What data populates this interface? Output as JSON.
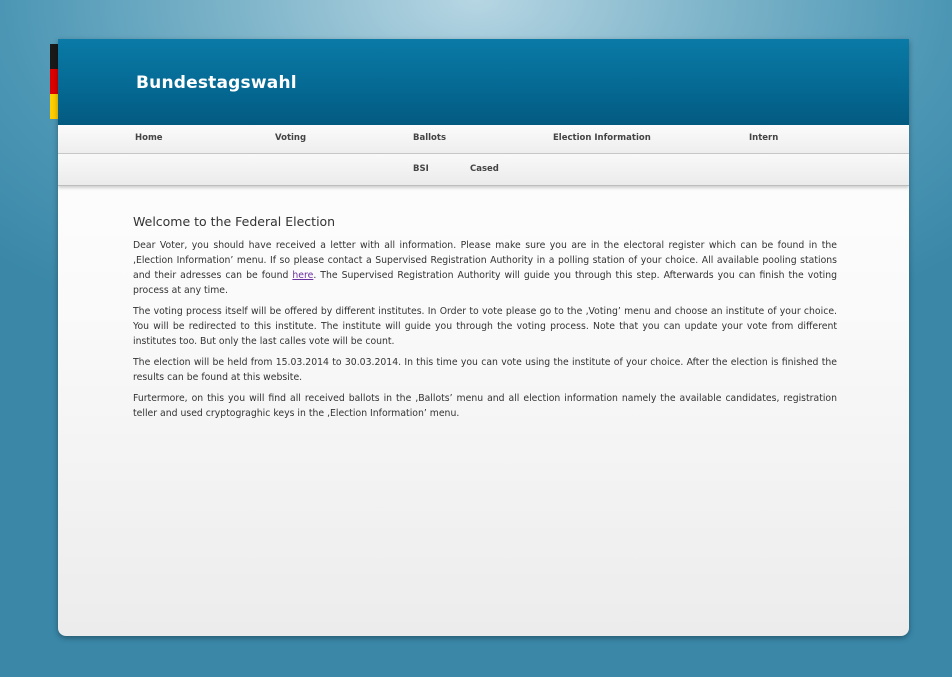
{
  "header": {
    "title": "Bundestagswahl"
  },
  "nav": {
    "main": [
      "Home",
      "Voting",
      "Ballots",
      "Election Information",
      "Intern"
    ],
    "sub": [
      "BSI",
      "Cased"
    ]
  },
  "content": {
    "heading": "Welcome to the Federal Election",
    "p1_before": "Dear Voter, you should have received a letter with all information. Please make sure you are in the electoral register which can be found in the ‚Election Information’ menu. If so please contact a Supervised Registration Authority in a polling station of your choice. All available pooling stations and their adresses can be found ",
    "p1_link": "here",
    "p1_after": ". The Supervised Registration Authority will guide you through this step. Afterwards you can finish the voting process at any time.",
    "p2": "The voting process itself will be offered by different institutes. In Order to vote please go to the ‚Voting’ menu and choose an institute of your choice. You will be redirected to this institute. The institute will guide you through the voting process. Note that you can update your vote from different institutes too. But only the last calles vote will be count.",
    "p3": "The election will be held from 15.03.2014 to 30.03.2014. In this time you can vote using the institute of your choice. After the election is finished the results can be found at this website.",
    "p4": "Furtermore, on this you will find all received ballots in the ‚Ballots’ menu and all election information namely the available candidates, registration teller and used cryptograghic keys in the ‚Election Information’ menu."
  },
  "colors": {
    "header": "#056a94",
    "flag_black": "#1a1a1a",
    "flag_red": "#dd0000",
    "flag_gold": "#ffce00",
    "link": "#6a2fa0"
  }
}
